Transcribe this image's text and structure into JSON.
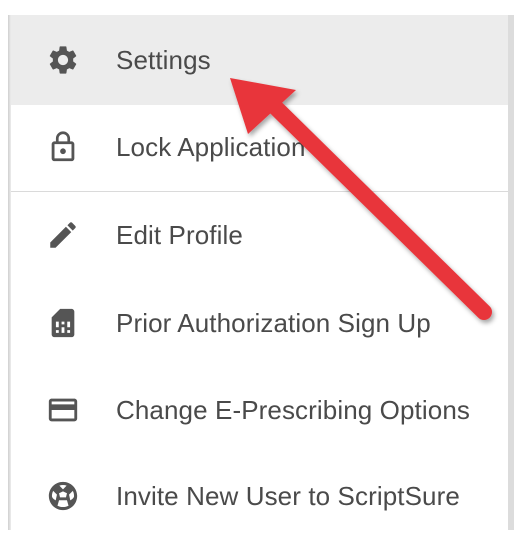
{
  "menu": {
    "items": [
      {
        "key": "settings",
        "label": "Settings",
        "icon": "gear-icon"
      },
      {
        "key": "lock",
        "label": "Lock Application",
        "icon": "lock-icon"
      },
      {
        "key": "edit",
        "label": "Edit Profile",
        "icon": "pencil-icon"
      },
      {
        "key": "prior",
        "label": "Prior Authorization Sign Up",
        "icon": "sim-card-icon"
      },
      {
        "key": "eprescribe",
        "label": "Change E-Prescribing Options",
        "icon": "credit-card-icon"
      },
      {
        "key": "invite",
        "label": "Invite New User to ScriptSure",
        "icon": "ball-icon"
      }
    ]
  },
  "colors": {
    "icon": "#555555",
    "label": "#4a4a4a",
    "highlight": "#ececec",
    "arrow": "#e8363b"
  }
}
